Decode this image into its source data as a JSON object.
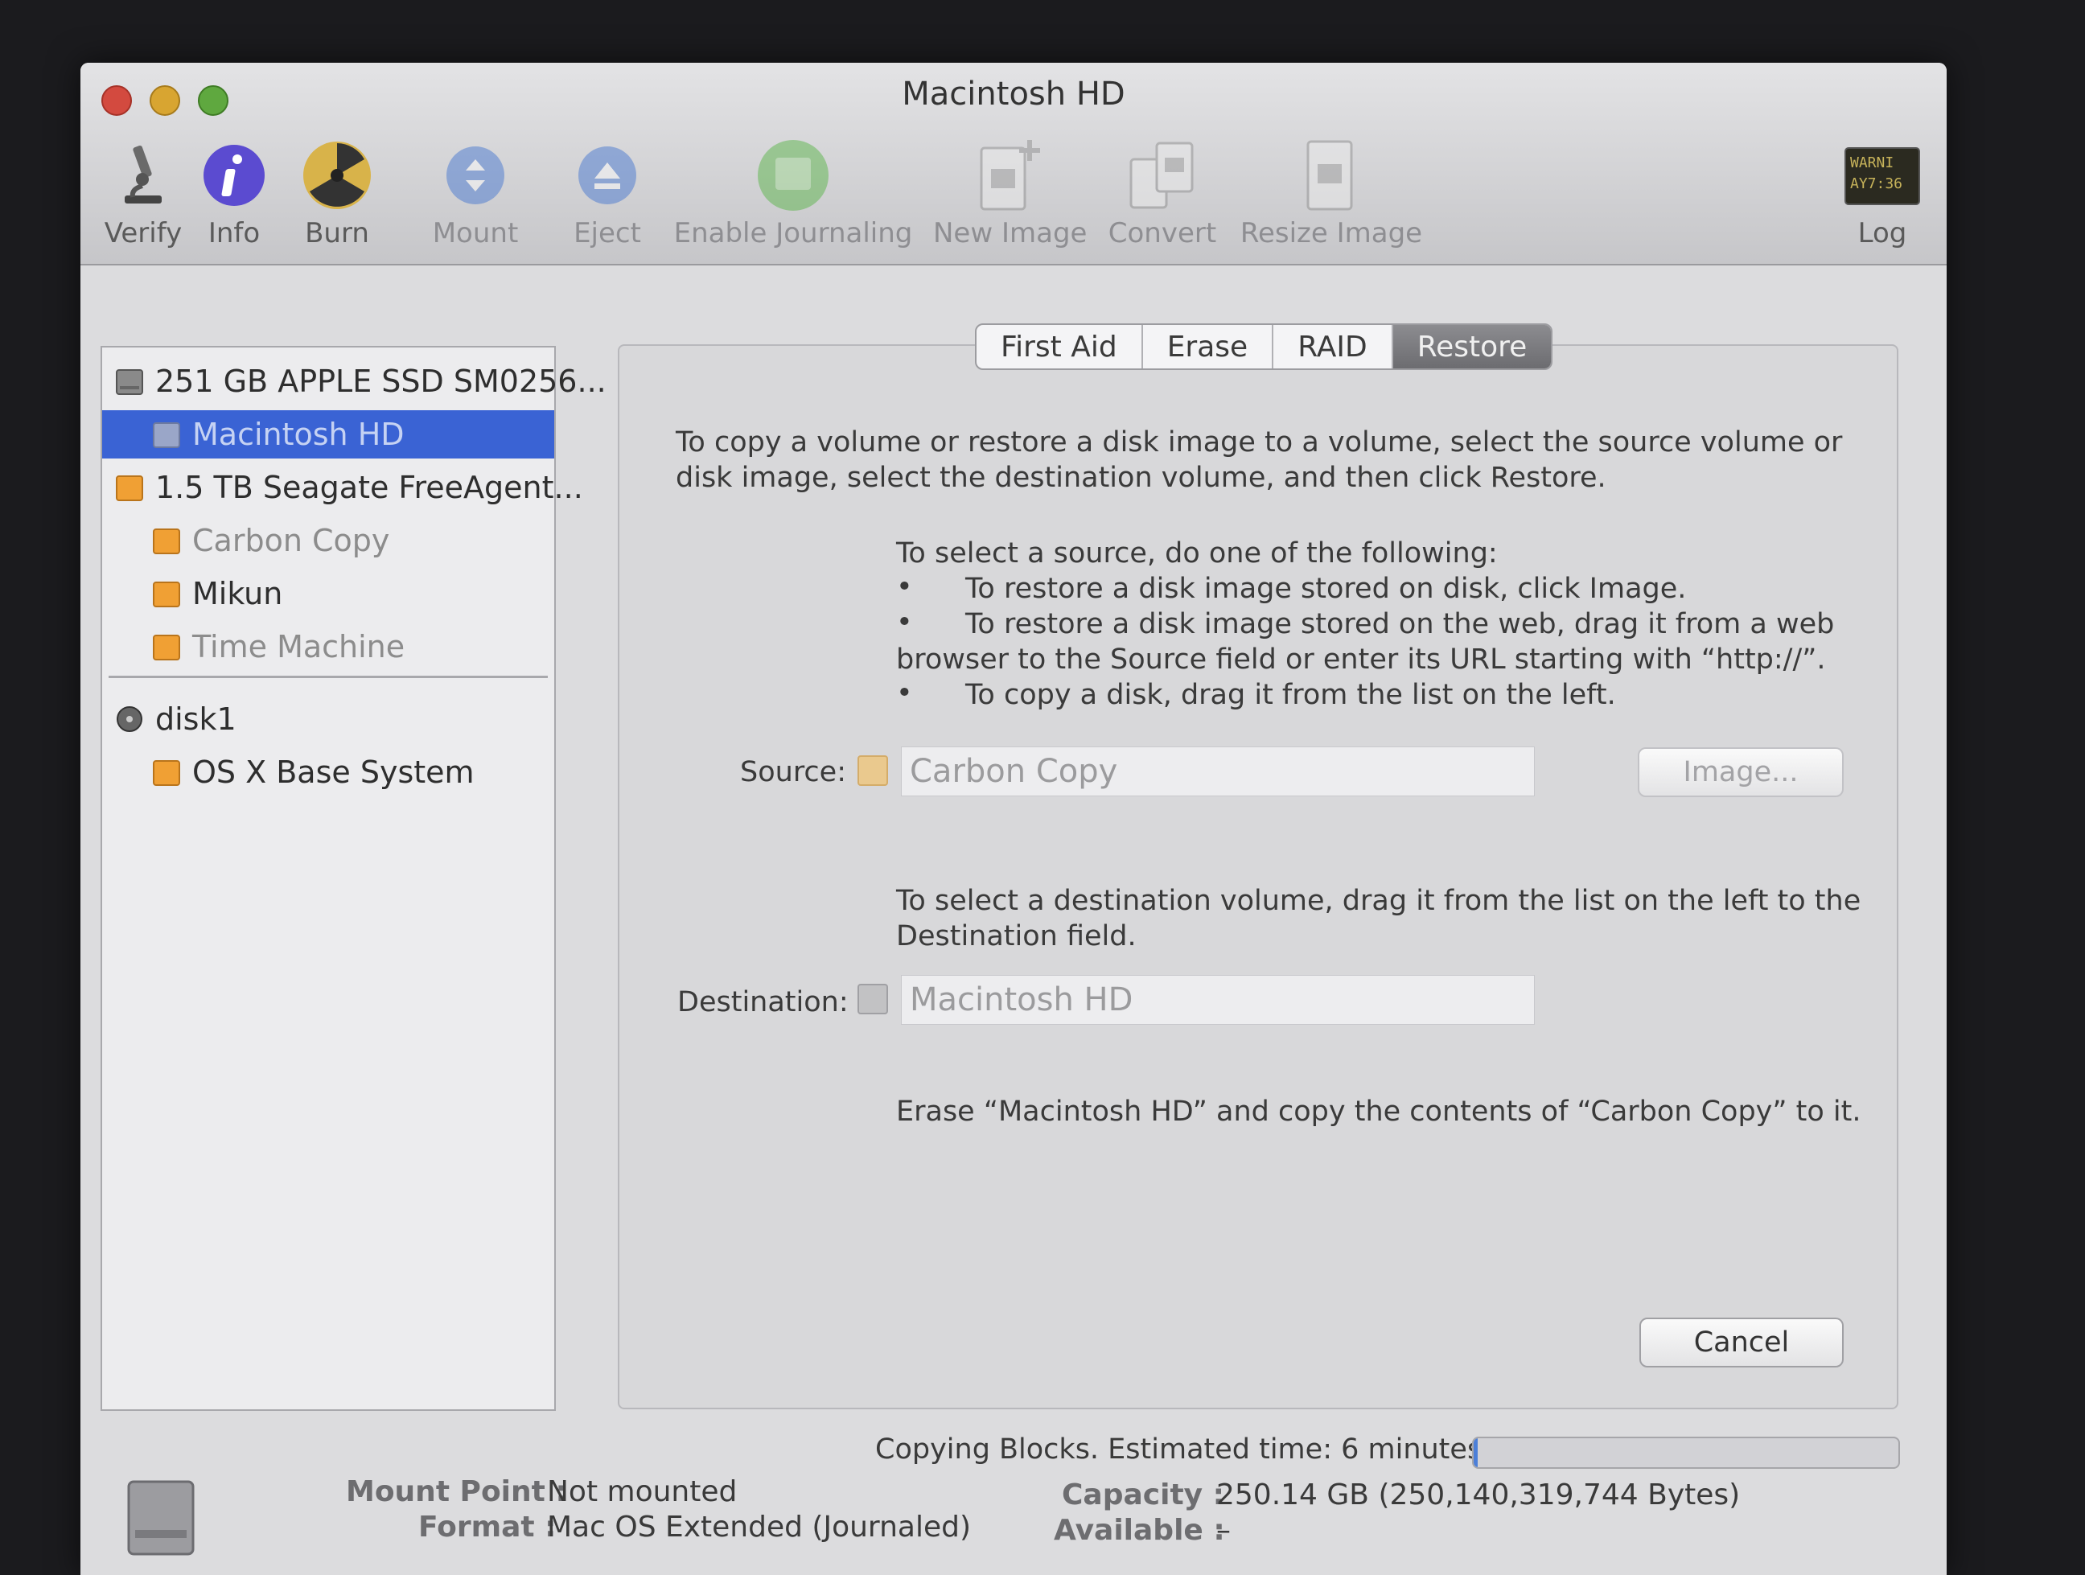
{
  "window": {
    "title": "Macintosh HD"
  },
  "toolbar": {
    "verify": "Verify",
    "info": "Info",
    "burn": "Burn",
    "mount": "Mount",
    "eject": "Eject",
    "enable_journaling": "Enable Journaling",
    "new_image": "New Image",
    "convert": "Convert",
    "resize_image": "Resize Image",
    "log": "Log",
    "log_icon_text": "WARNI\nAY7:36"
  },
  "sidebar": {
    "items": [
      {
        "label": "251 GB APPLE SSD SM0256..."
      },
      {
        "label": "Macintosh HD"
      },
      {
        "label": "1.5 TB Seagate FreeAgent..."
      },
      {
        "label": "Carbon Copy"
      },
      {
        "label": "Mikun"
      },
      {
        "label": "Time Machine"
      },
      {
        "label": "disk1"
      },
      {
        "label": "OS X Base System"
      }
    ]
  },
  "tabs": [
    "First Aid",
    "Erase",
    "RAID",
    "Restore"
  ],
  "restore": {
    "intro": "To copy a volume or restore a disk image to a volume, select the source volume or disk image, select the destination volume, and then click Restore.",
    "source_heading": "To select a source, do one of the following:",
    "bullet1": "To restore a disk image stored on disk, click Image.",
    "bullet2a": "To restore a disk image stored on the web, drag it from a web",
    "bullet2b": "browser to the Source field or enter its URL starting with “http://”.",
    "bullet3": "To copy a disk, drag it from the list on the left.",
    "source_label": "Source:",
    "source_value": "Carbon Copy",
    "image_button": "Image...",
    "dest_heading": "To select a destination volume, drag it from the list on the left to the Destination field.",
    "dest_label": "Destination:",
    "dest_value": "Macintosh HD",
    "summary": "Erase “Macintosh HD” and copy the contents of “Carbon Copy” to it.",
    "cancel_button": "Cancel"
  },
  "status": {
    "text": "Copying Blocks. Estimated time: 6 minutes",
    "progress": 0.01
  },
  "details": {
    "mount_point_label": "Mount Point :",
    "mount_point_value": "Not mounted",
    "format_label": "Format :",
    "format_value": "Mac OS Extended (Journaled)",
    "capacity_label": "Capacity :",
    "capacity_value": "250.14 GB (250,140,319,744 Bytes)",
    "available_label": "Available :",
    "available_value": "–"
  },
  "colors": {
    "selection": "#3a63d4",
    "progress_fill": "#4c7fd8",
    "external_drive": "#f0a034"
  }
}
